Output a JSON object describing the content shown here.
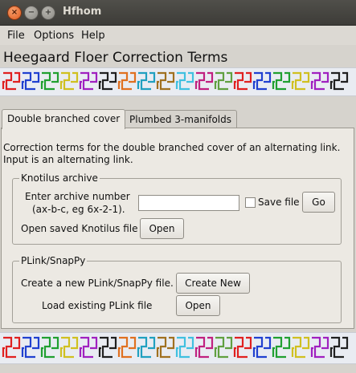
{
  "window": {
    "title": "Hfhom"
  },
  "window_controls": [
    "close",
    "minimize",
    "maximize"
  ],
  "menubar": {
    "items": [
      "File",
      "Options",
      "Help"
    ]
  },
  "app": {
    "heading": "Heegaard Floer Correction Terms"
  },
  "tabs": [
    {
      "label": "Double branched cover",
      "active": true
    },
    {
      "label": "Plumbed 3-manifolds",
      "active": false
    }
  ],
  "description": {
    "line1": "Correction terms for the double branched cover of  an alternating link.",
    "line2": "Input is an alternating link."
  },
  "knotilus": {
    "legend": "Knotilus archive",
    "enter_label_line1": "Enter archive number",
    "enter_label_line2": "(ax-b-c, eg 6x-2-1).",
    "archive_input_value": "",
    "save_file_label": "Save file",
    "save_file_checked": false,
    "go_label": "Go",
    "open_saved_label": "Open saved Knotilus file",
    "open_label": "Open"
  },
  "plink": {
    "legend": "PLink/SnapPy",
    "create_label": "Create a new PLink/SnapPy file.",
    "create_button": "Create New",
    "load_label": "Load existing PLink file",
    "open_label": "Open"
  },
  "knot_colors": [
    "#e02020",
    "#2040d0",
    "#20a030",
    "#d0c020",
    "#a020c0",
    "#202020",
    "#e07020",
    "#20a0c0",
    "#a07020",
    "#40c0e0",
    "#c02080",
    "#60a040"
  ]
}
